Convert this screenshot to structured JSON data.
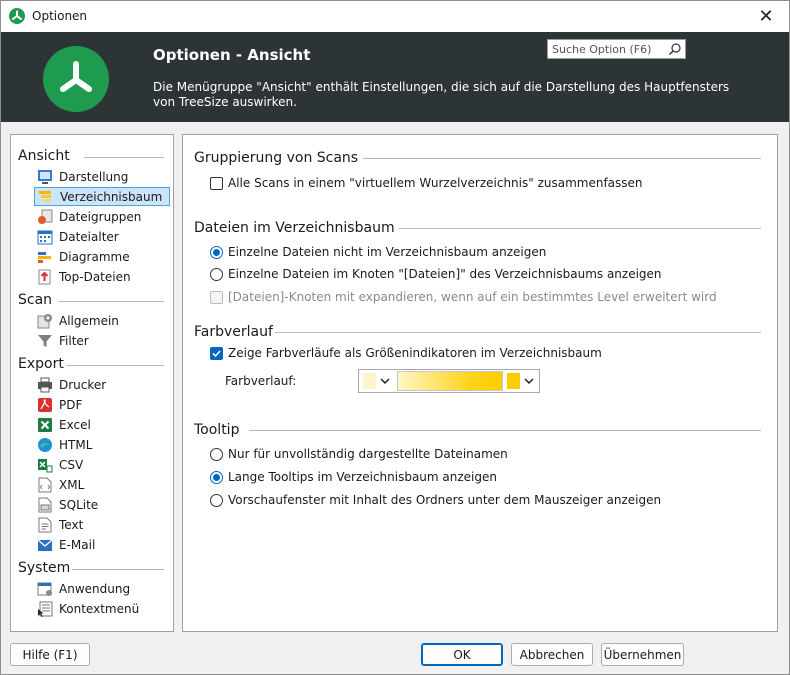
{
  "window": {
    "title": "Optionen",
    "close_glyph": "✕"
  },
  "header": {
    "title": "Optionen - Ansicht",
    "description": "Die Menügruppe \"Ansicht\" enthält Einstellungen, die sich auf die Darstellung des Hauptfensters von TreeSize auswirken.",
    "search_placeholder": "Suche Option (F6)"
  },
  "sidebar": {
    "groups": [
      {
        "label": "Ansicht",
        "items": [
          {
            "label": "Darstellung",
            "icon": "display-icon"
          },
          {
            "label": "Verzeichnisbaum",
            "icon": "directory-tree-icon",
            "selected": true
          },
          {
            "label": "Dateigruppen",
            "icon": "file-groups-icon"
          },
          {
            "label": "Dateialter",
            "icon": "calendar-icon"
          },
          {
            "label": "Diagramme",
            "icon": "chart-icon"
          },
          {
            "label": "Top-Dateien",
            "icon": "top-files-icon"
          }
        ]
      },
      {
        "label": "Scan",
        "items": [
          {
            "label": "Allgemein",
            "icon": "general-settings-icon"
          },
          {
            "label": "Filter",
            "icon": "filter-icon"
          }
        ]
      },
      {
        "label": "Export",
        "items": [
          {
            "label": "Drucker",
            "icon": "printer-icon"
          },
          {
            "label": "PDF",
            "icon": "pdf-icon"
          },
          {
            "label": "Excel",
            "icon": "excel-icon"
          },
          {
            "label": "HTML",
            "icon": "html-icon"
          },
          {
            "label": "CSV",
            "icon": "csv-icon"
          },
          {
            "label": "XML",
            "icon": "xml-icon"
          },
          {
            "label": "SQLite",
            "icon": "sqlite-icon"
          },
          {
            "label": "Text",
            "icon": "text-icon"
          },
          {
            "label": "E-Mail",
            "icon": "email-icon"
          }
        ]
      },
      {
        "label": "System",
        "items": [
          {
            "label": "Anwendung",
            "icon": "application-icon"
          },
          {
            "label": "Kontextmenü",
            "icon": "context-menu-icon"
          }
        ]
      }
    ]
  },
  "content": {
    "grouping": {
      "title": "Gruppierung von Scans",
      "option_virtual_root": {
        "label": "Alle Scans in einem \"virtuellem Wurzelverzeichnis\" zusammenfassen",
        "checked": false
      }
    },
    "files": {
      "title": "Dateien im Verzeichnisbaum",
      "radio_hide": {
        "label": "Einzelne Dateien nicht im Verzeichnisbaum anzeigen",
        "checked": true
      },
      "radio_node": {
        "label": "Einzelne Dateien im Knoten \"[Dateien]\" des Verzeichnisbaums anzeigen",
        "checked": false
      },
      "option_expand": {
        "label": "[Dateien]-Knoten mit expandieren, wenn auf ein bestimmtes Level erweitert wird",
        "checked": false,
        "disabled": true
      }
    },
    "gradient": {
      "title": "Farbverlauf",
      "option_show": {
        "label": "Zeige Farbverläufe als Größenindikatoren im Verzeichnisbaum",
        "checked": true
      },
      "combo_label": "Farbverlauf:",
      "start_color": "#fff3cc",
      "end_color": "#ffcc00"
    },
    "tooltip": {
      "title": "Tooltip",
      "radio_incomplete": {
        "label": "Nur für unvollständig dargestellte Dateinamen",
        "checked": false
      },
      "radio_long": {
        "label": "Lange Tooltips im Verzeichnisbaum anzeigen",
        "checked": true
      },
      "radio_preview": {
        "label": "Vorschaufenster mit Inhalt des Ordners unter dem Mauszeiger anzeigen",
        "checked": false
      }
    }
  },
  "footer": {
    "help_label": "Hilfe (F1)",
    "ok_label": "OK",
    "cancel_label": "Abbrechen",
    "apply_label": "Übernehmen"
  },
  "colors": {
    "brand_green": "#1e9b4f",
    "header_bg": "#2d3436",
    "accent_blue": "#0067c0",
    "selection_bg": "#cce4f7"
  }
}
